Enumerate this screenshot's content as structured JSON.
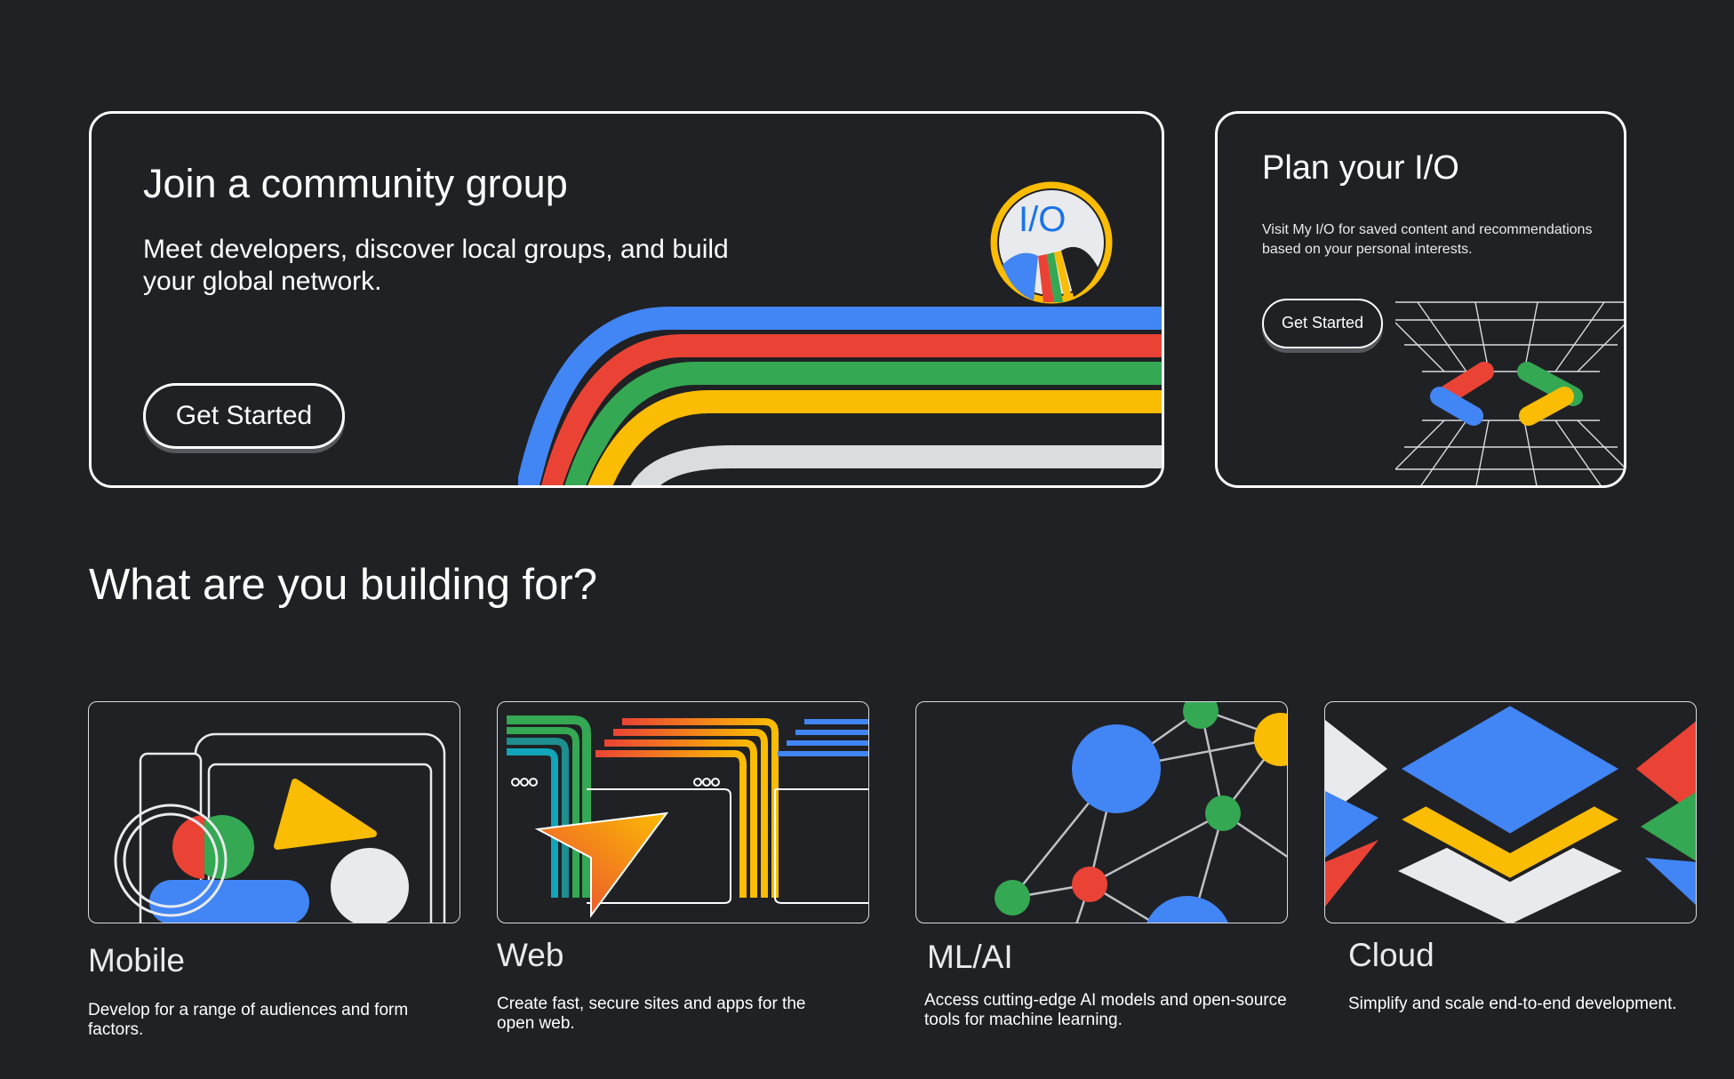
{
  "community": {
    "title": "Join a community group",
    "description": "Meet developers, discover local groups, and build your global network.",
    "button_label": "Get Started",
    "badge_text": "I/O",
    "stripe_colors": [
      "#4285f4",
      "#ea4335",
      "#34a853",
      "#fbbc04",
      "#dadce0"
    ]
  },
  "plan": {
    "title": "Plan your I/O",
    "description": "Visit My I/O for saved content and recommendations based on your personal interests.",
    "button_label": "Get Started"
  },
  "section": {
    "heading": "What are you building for?"
  },
  "categories": [
    {
      "title": "Mobile",
      "description": "Develop for a range of audiences and form factors."
    },
    {
      "title": "Web",
      "description": "Create fast, secure sites and apps for the open web."
    },
    {
      "title": "ML/AI",
      "description": "Access cutting-edge AI models and open-source tools for machine learning."
    },
    {
      "title": "Cloud",
      "description": "Simplify and scale end-to-end development."
    }
  ],
  "colors": {
    "background": "#202124",
    "blue": "#4285f4",
    "red": "#ea4335",
    "green": "#34a853",
    "yellow": "#fbbc04",
    "grey": "#dadce0"
  }
}
